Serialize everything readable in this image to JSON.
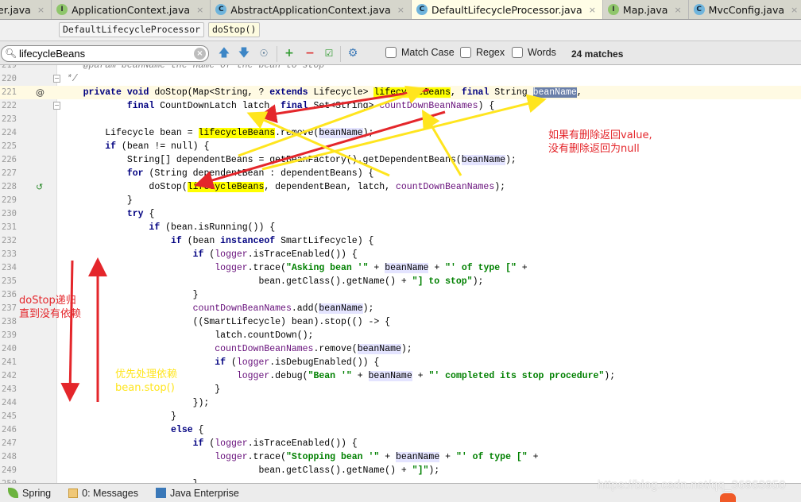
{
  "tabs": [
    {
      "label": "er.java",
      "icon": "none",
      "active": false
    },
    {
      "label": "ApplicationContext.java",
      "icon": "interface-icon",
      "active": false
    },
    {
      "label": "AbstractApplicationContext.java",
      "icon": "class-icon",
      "active": false
    },
    {
      "label": "DefaultLifecycleProcessor.java",
      "icon": "class-icon",
      "active": true
    },
    {
      "label": "Map.java",
      "icon": "interface-icon",
      "active": false
    },
    {
      "label": "MvcConfig.java",
      "icon": "class-icon",
      "active": false
    }
  ],
  "tab_close_glyph": "×",
  "breadcrumb": {
    "class_name": "DefaultLifecycleProcessor",
    "method_name": "doStop()"
  },
  "find_bar": {
    "query": "lifecycleBeans",
    "options": [
      "Match Case",
      "Regex",
      "Words"
    ],
    "match_count": "24 matches",
    "icons": [
      "previous-occurrence-icon",
      "next-occurrence-icon",
      "find-all-icon",
      "add-selection-icon",
      "remove-selection-icon",
      "select-all-icon",
      "settings-icon"
    ]
  },
  "editor": {
    "caret_line": 221,
    "lines": [
      {
        "n": 219,
        "partial_text": "@param beanName the name of the bean to stop"
      },
      {
        "n": 220,
        "text": " */"
      },
      {
        "n": 221,
        "text": "private void doStop(Map<String, ? extends Lifecycle> lifecycleBeans, final String beanName,",
        "gutter": "@"
      },
      {
        "n": 222,
        "text": "        final CountDownLatch latch, final Set<String> countDownBeanNames) {"
      },
      {
        "n": 223,
        "text": ""
      },
      {
        "n": 224,
        "text": "    Lifecycle bean = lifecycleBeans.remove(beanName);"
      },
      {
        "n": 225,
        "text": "    if (bean != null) {"
      },
      {
        "n": 226,
        "text": "        String[] dependentBeans = getBeanFactory().getDependentBeans(beanName);"
      },
      {
        "n": 227,
        "text": "        for (String dependentBean : dependentBeans) {"
      },
      {
        "n": 228,
        "text": "            doStop(lifecycleBeans, dependentBean, latch, countDownBeanNames);",
        "gutter": "recursive-call"
      },
      {
        "n": 229,
        "text": "        }"
      },
      {
        "n": 230,
        "text": "        try {"
      },
      {
        "n": 231,
        "text": "            if (bean.isRunning()) {"
      },
      {
        "n": 232,
        "text": "                if (bean instanceof SmartLifecycle) {"
      },
      {
        "n": 233,
        "text": "                    if (logger.isTraceEnabled()) {"
      },
      {
        "n": 234,
        "text": "                        logger.trace(\"Asking bean '\" + beanName + \"' of type [\" +"
      },
      {
        "n": 235,
        "text": "                                bean.getClass().getName() + \"] to stop\");"
      },
      {
        "n": 236,
        "text": "                    }"
      },
      {
        "n": 237,
        "text": "                    countDownBeanNames.add(beanName);"
      },
      {
        "n": 238,
        "text": "                    ((SmartLifecycle) bean).stop(() -> {"
      },
      {
        "n": 239,
        "text": "                        latch.countDown();"
      },
      {
        "n": 240,
        "text": "                        countDownBeanNames.remove(beanName);"
      },
      {
        "n": 241,
        "text": "                        if (logger.isDebugEnabled()) {"
      },
      {
        "n": 242,
        "text": "                            logger.debug(\"Bean '\" + beanName + \"' completed its stop procedure\");"
      },
      {
        "n": 243,
        "text": "                        }"
      },
      {
        "n": 244,
        "text": "                    });"
      },
      {
        "n": 245,
        "text": "                }"
      },
      {
        "n": 246,
        "text": "                else {"
      },
      {
        "n": 247,
        "text": "                    if (logger.isTraceEnabled()) {"
      },
      {
        "n": 248,
        "text": "                        logger.trace(\"Stopping bean '\" + beanName + \"' of type [\" +"
      },
      {
        "n": 249,
        "text": "                                bean.getClass().getName() + \"]\");"
      },
      {
        "n": 250,
        "text": "                    }"
      }
    ]
  },
  "annotations": {
    "remove_note": "如果有删除返回value,\n没有删除返回为null",
    "recursion_note": "doStop递归\n直到没有依赖",
    "dependency_note": "优先处理依赖\nbean.stop()",
    "colors": {
      "red": "#e4262b",
      "yellow": "#ffe51e"
    }
  },
  "status_bar": {
    "items": [
      {
        "label": "Spring",
        "icon": "spring-leaf-icon"
      },
      {
        "label": "0: Messages",
        "icon": "messages-icon"
      },
      {
        "label": "Java Enterprise",
        "icon": "java-enterprise-icon"
      }
    ],
    "watermark": "https://blog.csdn.net/qq_36963950"
  }
}
